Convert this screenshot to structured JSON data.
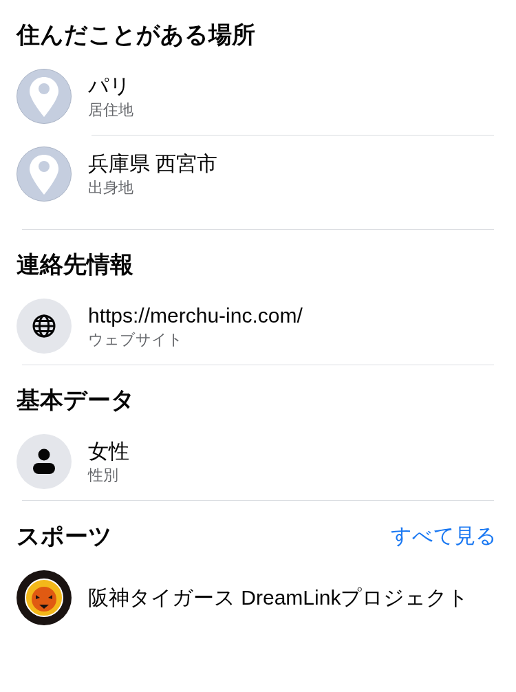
{
  "sections": [
    {
      "heading": "住んだことがある場所",
      "items": [
        {
          "kind": "place",
          "primary": "パリ",
          "secondary": "居住地"
        },
        {
          "kind": "place",
          "primary": "兵庫県 西宮市",
          "secondary": "出身地"
        }
      ]
    },
    {
      "heading": "連絡先情報",
      "items": [
        {
          "kind": "website",
          "primary": "https://merchu-inc.com/",
          "secondary": "ウェブサイト"
        }
      ]
    },
    {
      "heading": "基本データ",
      "items": [
        {
          "kind": "gender",
          "primary": "女性",
          "secondary": "性別"
        }
      ]
    },
    {
      "heading": "スポーツ",
      "see_all": "すべて見る",
      "items": [
        {
          "kind": "team",
          "primary": "阪神タイガース DreamLinkプロジェクト"
        }
      ]
    }
  ]
}
